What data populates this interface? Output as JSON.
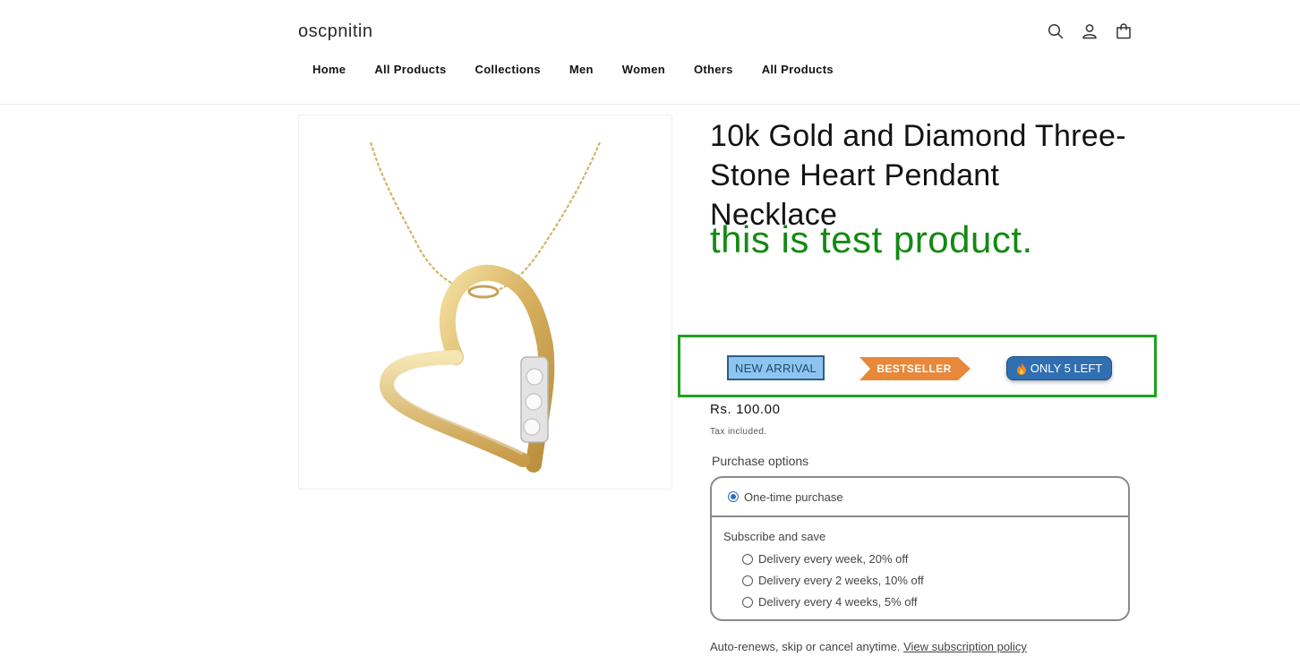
{
  "header": {
    "logo": "oscpnitin",
    "icons": [
      "search-icon",
      "account-icon",
      "cart-icon"
    ],
    "nav": [
      "Home",
      "All Products",
      "Collections",
      "Men",
      "Women",
      "Others",
      "All Products"
    ]
  },
  "product": {
    "title": "10k Gold and Diamond Three-Stone Heart Pendant Necklace",
    "tagline": "this is test product.",
    "badges": {
      "new": "NEW ARRIVAL",
      "best": "BESTSELLER",
      "stock": "ONLY 5 LEFT",
      "stock_icon": "fire-icon"
    },
    "price": "Rs. 100.00",
    "tax": "Tax included.",
    "purchase": {
      "label": "Purchase options",
      "one_time": "One-time purchase",
      "subscribe_title": "Subscribe and save",
      "options": [
        "Delivery every week, 20% off",
        "Delivery every 2 weeks, 10% off",
        "Delivery every 4 weeks, 5% off"
      ]
    },
    "renew_text": "Auto-renews, skip or cancel anytime.",
    "renew_link": "View subscription policy"
  },
  "colors": {
    "tagline": "#138a13",
    "highlight_box": "#1fa21f",
    "new_badge_bg": "#8ec5f0",
    "best_badge_bg": "#e8883a",
    "stock_badge_bg": "#2f6fb2",
    "radio_selected": "#2a6fb8"
  }
}
